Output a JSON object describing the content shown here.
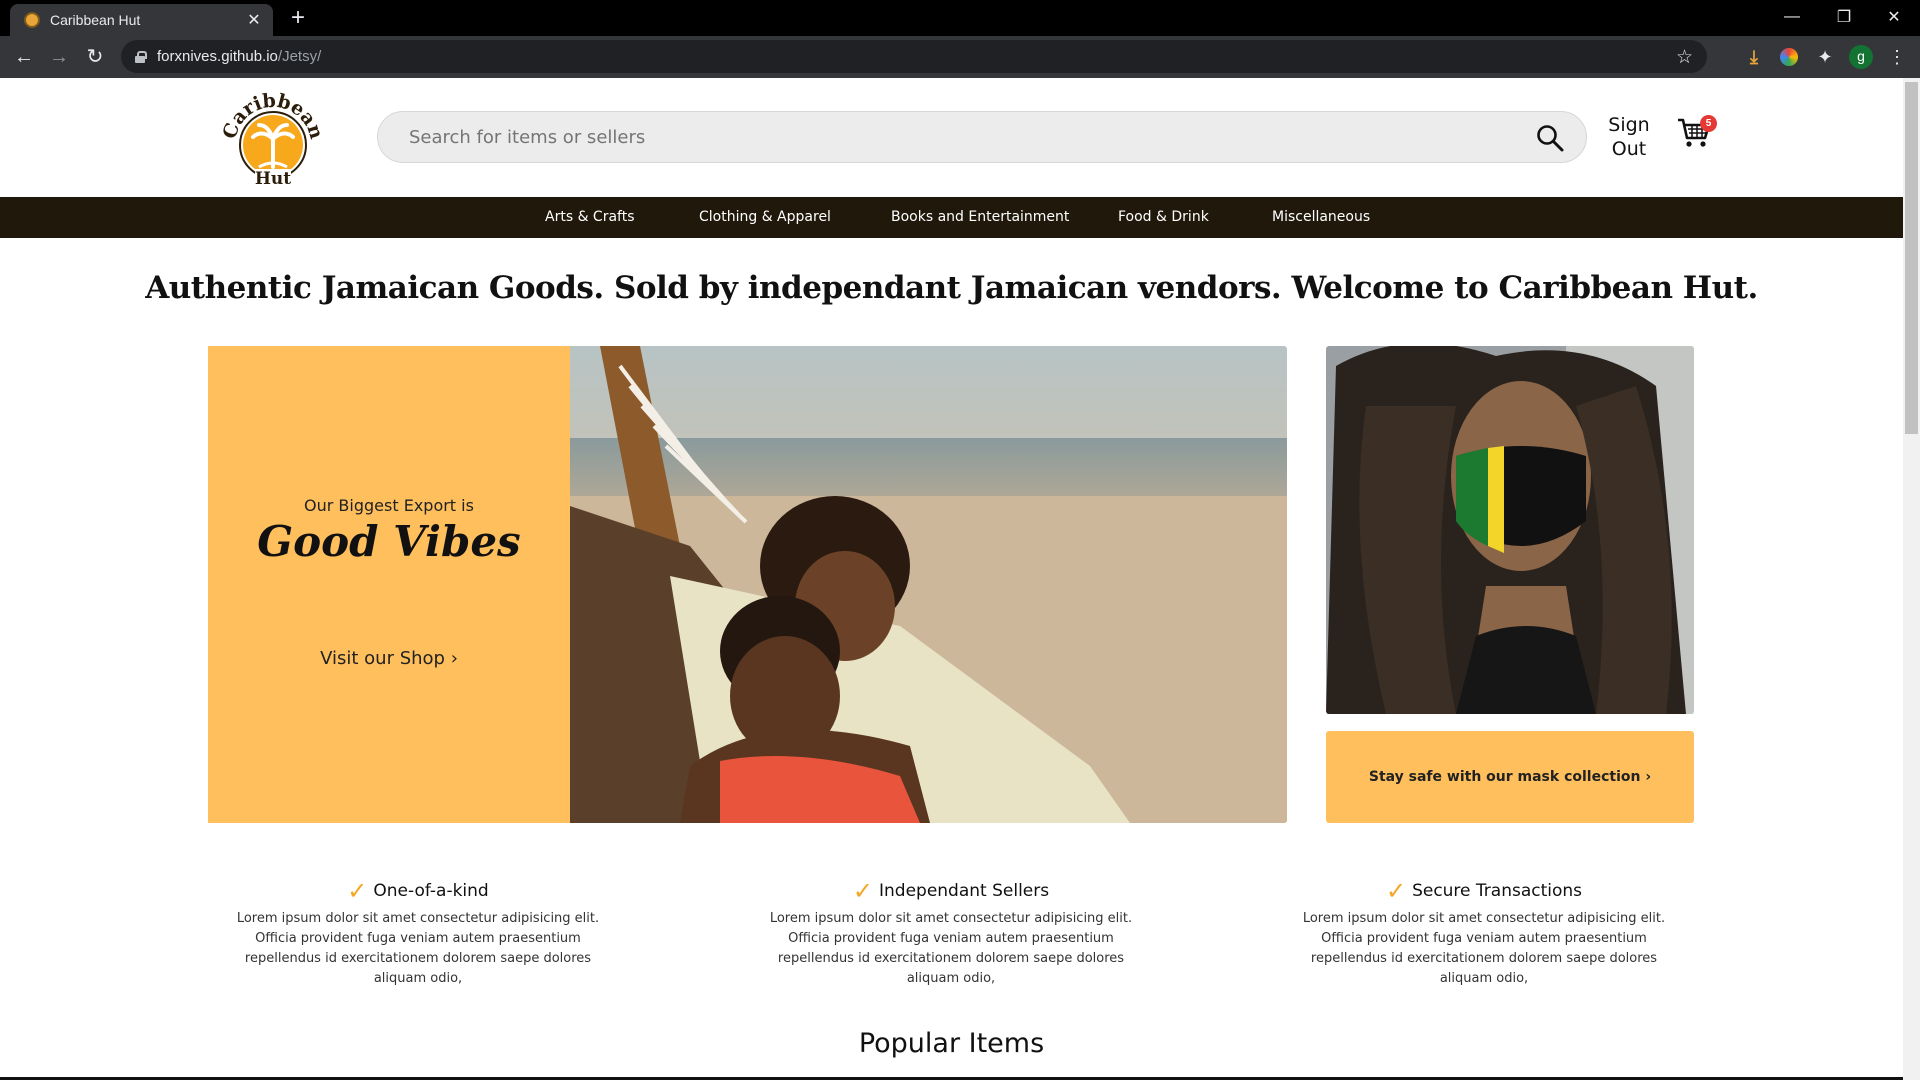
{
  "browser": {
    "tab_title": "Caribbean Hut",
    "url_host": "forxnives.github.io",
    "url_path": "/Jetsy/",
    "profile_initial": "g"
  },
  "header": {
    "logo_text_top": "Caribbean",
    "logo_text_bottom": "Hut",
    "search_placeholder": "Search for items or sellers",
    "sign_out_line1": "Sign",
    "sign_out_line2": "Out",
    "cart_count": "5"
  },
  "categories": [
    "Arts & Crafts",
    "Clothing & Apparel",
    "Books and Entertainment",
    "Food & Drink",
    "Miscellaneous"
  ],
  "headline": "Authentic Jamaican Goods. Sold by independant Jamaican vendors. Welcome to Caribbean Hut.",
  "hero": {
    "kicker": "Our Biggest Export is",
    "big_text": "Good Vibes",
    "cta": "Visit our Shop",
    "cta_chevron": "›"
  },
  "side_promo": {
    "cta": "Stay safe with our mask collection",
    "cta_chevron": "›"
  },
  "features": [
    {
      "title": "One-of-a-kind",
      "desc": "Lorem ipsum dolor sit amet consectetur adipisicing elit. Officia provident fuga veniam autem praesentium repellendus id exercitationem dolorem saepe dolores aliquam odio,"
    },
    {
      "title": "Independant Sellers",
      "desc": "Lorem ipsum dolor sit amet consectetur adipisicing elit. Officia provident fuga veniam autem praesentium repellendus id exercitationem dolorem saepe dolores aliquam odio,"
    },
    {
      "title": "Secure Transactions",
      "desc": "Lorem ipsum dolor sit amet consectetur adipisicing elit. Officia provident fuga veniam autem praesentium repellendus id exercitationem dolorem saepe dolores aliquam odio,"
    }
  ],
  "popular_heading": "Popular Items",
  "colors": {
    "accent": "#ffbf5c",
    "nav_bar": "#20180b",
    "badge": "#e53935",
    "check": "#f5a623"
  }
}
